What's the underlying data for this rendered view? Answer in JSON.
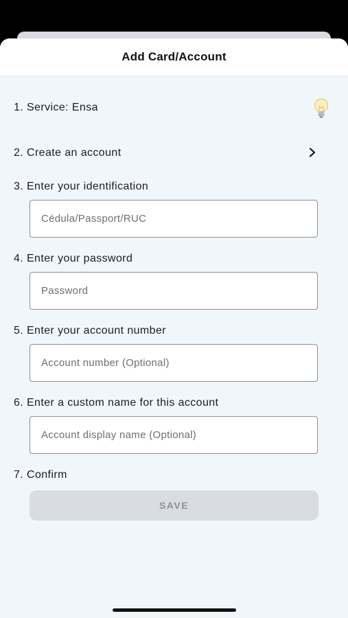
{
  "header": {
    "title": "Add Card/Account"
  },
  "steps": {
    "service": "1. Service: Ensa",
    "create_account": "2. Create an account",
    "identification": "3. Enter your identification",
    "password": "4. Enter your password",
    "account_number": "5. Enter your account number",
    "custom_name": "6. Enter a custom name for this account",
    "confirm": "7. Confirm"
  },
  "inputs": {
    "identification": {
      "value": "",
      "placeholder": "Cédula/Passport/RUC"
    },
    "password": {
      "value": "",
      "placeholder": "Password"
    },
    "account_number": {
      "value": "",
      "placeholder": "Account number (Optional)"
    },
    "display_name": {
      "value": "",
      "placeholder": "Account display name (Optional)"
    }
  },
  "buttons": {
    "save": "SAVE"
  },
  "icons": {
    "hint": "lightbulb-icon",
    "create_account": "chevron-right-icon"
  },
  "colors": {
    "sheet_background": "#f1f6fb",
    "save_disabled_bg": "#d9dce2",
    "save_disabled_text": "#8d9096"
  }
}
